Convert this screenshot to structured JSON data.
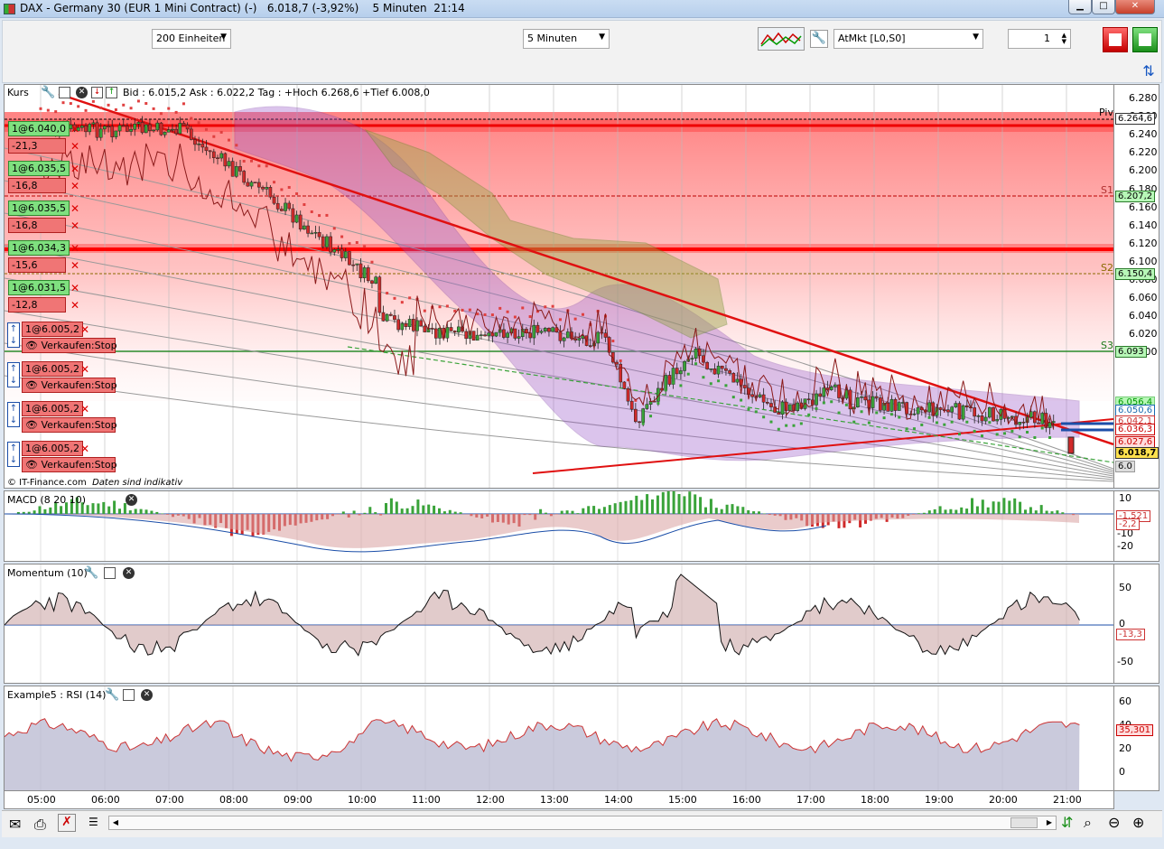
{
  "window": {
    "title": "DAX - Germany 30 (EUR 1 Mini Contract) (-)",
    "last": "6.018,7 (-3,92%)",
    "interval": "5 Minuten",
    "time": "21:14",
    "min": "▁",
    "max": "□",
    "close": "✕"
  },
  "toolbar": {
    "units": "200 Einheiten",
    "period": "5 Minuten",
    "order_type": "AtMkt [L0,S0]",
    "quantity": "1"
  },
  "price_pane": {
    "title": "Kurs",
    "info": "Bid : 6.015,2 Ask : 6.022,2  Tag : +Hoch 6.268,6 +Tief 6.008,0",
    "copyright": "© IT-Finance.com",
    "disclaimer": "Daten sind indikativ",
    "y_ticks": [
      "6.280",
      "6.260",
      "6.240",
      "6.220",
      "6.200",
      "6.180",
      "6.160",
      "6.140",
      "6.120",
      "6.100",
      "6.080",
      "6.060",
      "6.040",
      "6.020",
      "6.000"
    ],
    "levels": {
      "piv": "Piv",
      "s1": "S1",
      "s2": "S2",
      "s3": "S3"
    },
    "tags": {
      "piv": "6.264,6",
      "s1": "6.207,2",
      "s2": "6.150,4",
      "s3": "6.093",
      "t1": "6.056,4",
      "t2": "6.050,6",
      "t3": "6.042,1",
      "t4": "6.036,3",
      "t5": "6.027,6",
      "last": "6.018,7",
      "t6": "6.0"
    },
    "orders": [
      {
        "price": "1@6.040,0",
        "pl": "-21,3"
      },
      {
        "price": "1@6.035,5",
        "pl": "-16,8"
      },
      {
        "price": "1@6.035,5",
        "pl": "-16,8"
      },
      {
        "price": "1@6.034,3",
        "pl": "-15,6"
      },
      {
        "price": "1@6.031,5",
        "pl": "-12,8"
      }
    ],
    "stops": [
      {
        "price": "1@6.005,2",
        "label": "Verkaufen:Stop"
      },
      {
        "price": "1@6.005,2",
        "label": "Verkaufen:Stop"
      },
      {
        "price": "1@6.005,2",
        "label": "Verkaufen:Stop"
      },
      {
        "price": "1@6.005,2",
        "label": "Verkaufen:Stop"
      }
    ]
  },
  "macd_pane": {
    "title": "MACD (8 20 10)",
    "y_ticks": [
      "10",
      "-10",
      "-20"
    ],
    "tag1": "-1,521",
    "tag2": "-2,2"
  },
  "momentum_pane": {
    "title": "Momentum (10)",
    "y_ticks": [
      "50",
      "0",
      "-50"
    ],
    "tag": "-13,3"
  },
  "rsi_pane": {
    "title": "Example5 : RSI (14)",
    "y_ticks": [
      "60",
      "40",
      "20",
      "0"
    ],
    "tag": "35,301"
  },
  "time_axis": [
    "05:00",
    "06:00",
    "07:00",
    "08:00",
    "09:00",
    "10:00",
    "11:00",
    "12:00",
    "13:00",
    "14:00",
    "15:00",
    "16:00",
    "17:00",
    "18:00",
    "19:00",
    "20:00",
    "21:00"
  ],
  "colors": {
    "bull": "#3aa33a",
    "bear": "#d02a2a",
    "zone": "#ff6a6a",
    "cloud": "#9b59c9"
  }
}
